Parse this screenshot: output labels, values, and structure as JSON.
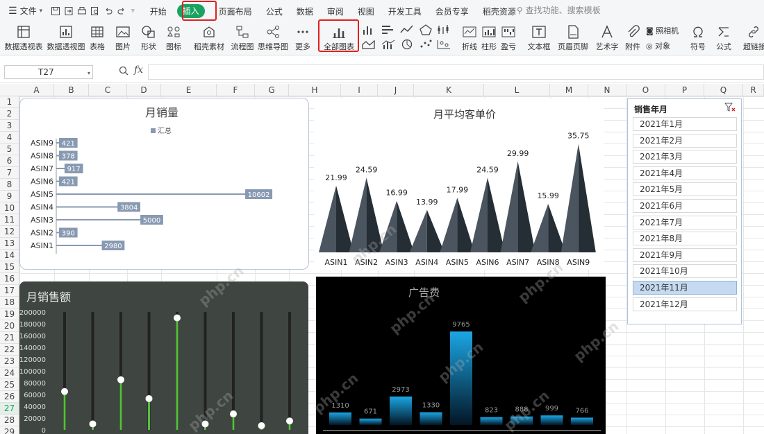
{
  "menubar": {
    "file_menu": "文件",
    "tabs": [
      "开始",
      "插入",
      "页面布局",
      "公式",
      "数据",
      "审阅",
      "视图",
      "开发工具",
      "会员专享",
      "稻壳资源"
    ],
    "active_tab": "插入",
    "search_placeholder": "查找功能、搜索模板"
  },
  "ribbon": {
    "buttons": [
      "数据透视表",
      "数据透视图",
      "表格",
      "图片",
      "形状",
      "图标",
      "稻壳素材",
      "流程图",
      "思维导图",
      "更多",
      "全部图表",
      "折线",
      "柱形",
      "盈亏",
      "文本框",
      "页眉页脚",
      "艺术字",
      "附件",
      "照相机",
      "对象",
      "符号",
      "公式",
      "超链接"
    ]
  },
  "formula_bar": {
    "name_box": "T27",
    "fx_label": "fx",
    "formula": ""
  },
  "columns": [
    "A",
    "B",
    "C",
    "D",
    "E",
    "F",
    "G",
    "H",
    "I",
    "J",
    "K",
    "L",
    "M",
    "N",
    "O",
    "P",
    "Q",
    "R"
  ],
  "rows": [
    "1",
    "2",
    "3",
    "4",
    "5",
    "6",
    "7",
    "8",
    "9",
    "10",
    "11",
    "12",
    "13",
    "14",
    "15",
    "16",
    "17",
    "18",
    "19",
    "20",
    "21",
    "22",
    "23",
    "24",
    "25",
    "26",
    "27",
    "28",
    "29"
  ],
  "active_row": "27",
  "chart_data": [
    {
      "type": "bar",
      "title": "月销量",
      "legend": [
        "汇总"
      ],
      "legend_position": "top",
      "categories": [
        "ASIN1",
        "ASIN2",
        "ASIN3",
        "ASIN4",
        "ASIN5",
        "ASIN6",
        "ASIN7",
        "ASIN8",
        "ASIN9"
      ],
      "values": [
        2980,
        390,
        5000,
        3804,
        10602,
        421,
        917,
        378,
        421
      ],
      "orientation": "horizontal",
      "bar_color": "#8899b2"
    },
    {
      "type": "bar",
      "title": "月平均客单价",
      "categories": [
        "ASIN1",
        "ASIN2",
        "ASIN3",
        "ASIN4",
        "ASIN5",
        "ASIN6",
        "ASIN7",
        "ASIN8",
        "ASIN9"
      ],
      "values": [
        21.99,
        24.59,
        16.99,
        13.99,
        17.99,
        24.59,
        29.99,
        15.99,
        35.75
      ],
      "shape": "triangle",
      "bar_color": "#2d3640"
    },
    {
      "type": "scatter",
      "title": "月销售额",
      "ylim": [
        0,
        200000
      ],
      "yticks": [
        "0",
        "20000",
        "40000",
        "60000",
        "80000",
        "100000",
        "120000",
        "140000",
        "160000",
        "180000",
        "200000"
      ],
      "values": [
        65000,
        10000,
        85000,
        53000,
        190000,
        10000,
        27000,
        7000,
        15000
      ],
      "point_color": "#ffffff",
      "stem_color": "#55c13a"
    },
    {
      "type": "bar",
      "title": "广告费",
      "values": [
        1310,
        671,
        2973,
        1330,
        9765,
        823,
        888,
        999,
        766
      ],
      "bar_color": "#1a9ad9"
    }
  ],
  "slicer": {
    "title": "销售年月",
    "items": [
      "2021年1月",
      "2021年2月",
      "2021年3月",
      "2021年4月",
      "2021年5月",
      "2021年6月",
      "2021年7月",
      "2021年8月",
      "2021年9月",
      "2021年10月",
      "2021年11月",
      "2021年12月"
    ],
    "selected": "2021年11月"
  },
  "watermark": "php.cn"
}
